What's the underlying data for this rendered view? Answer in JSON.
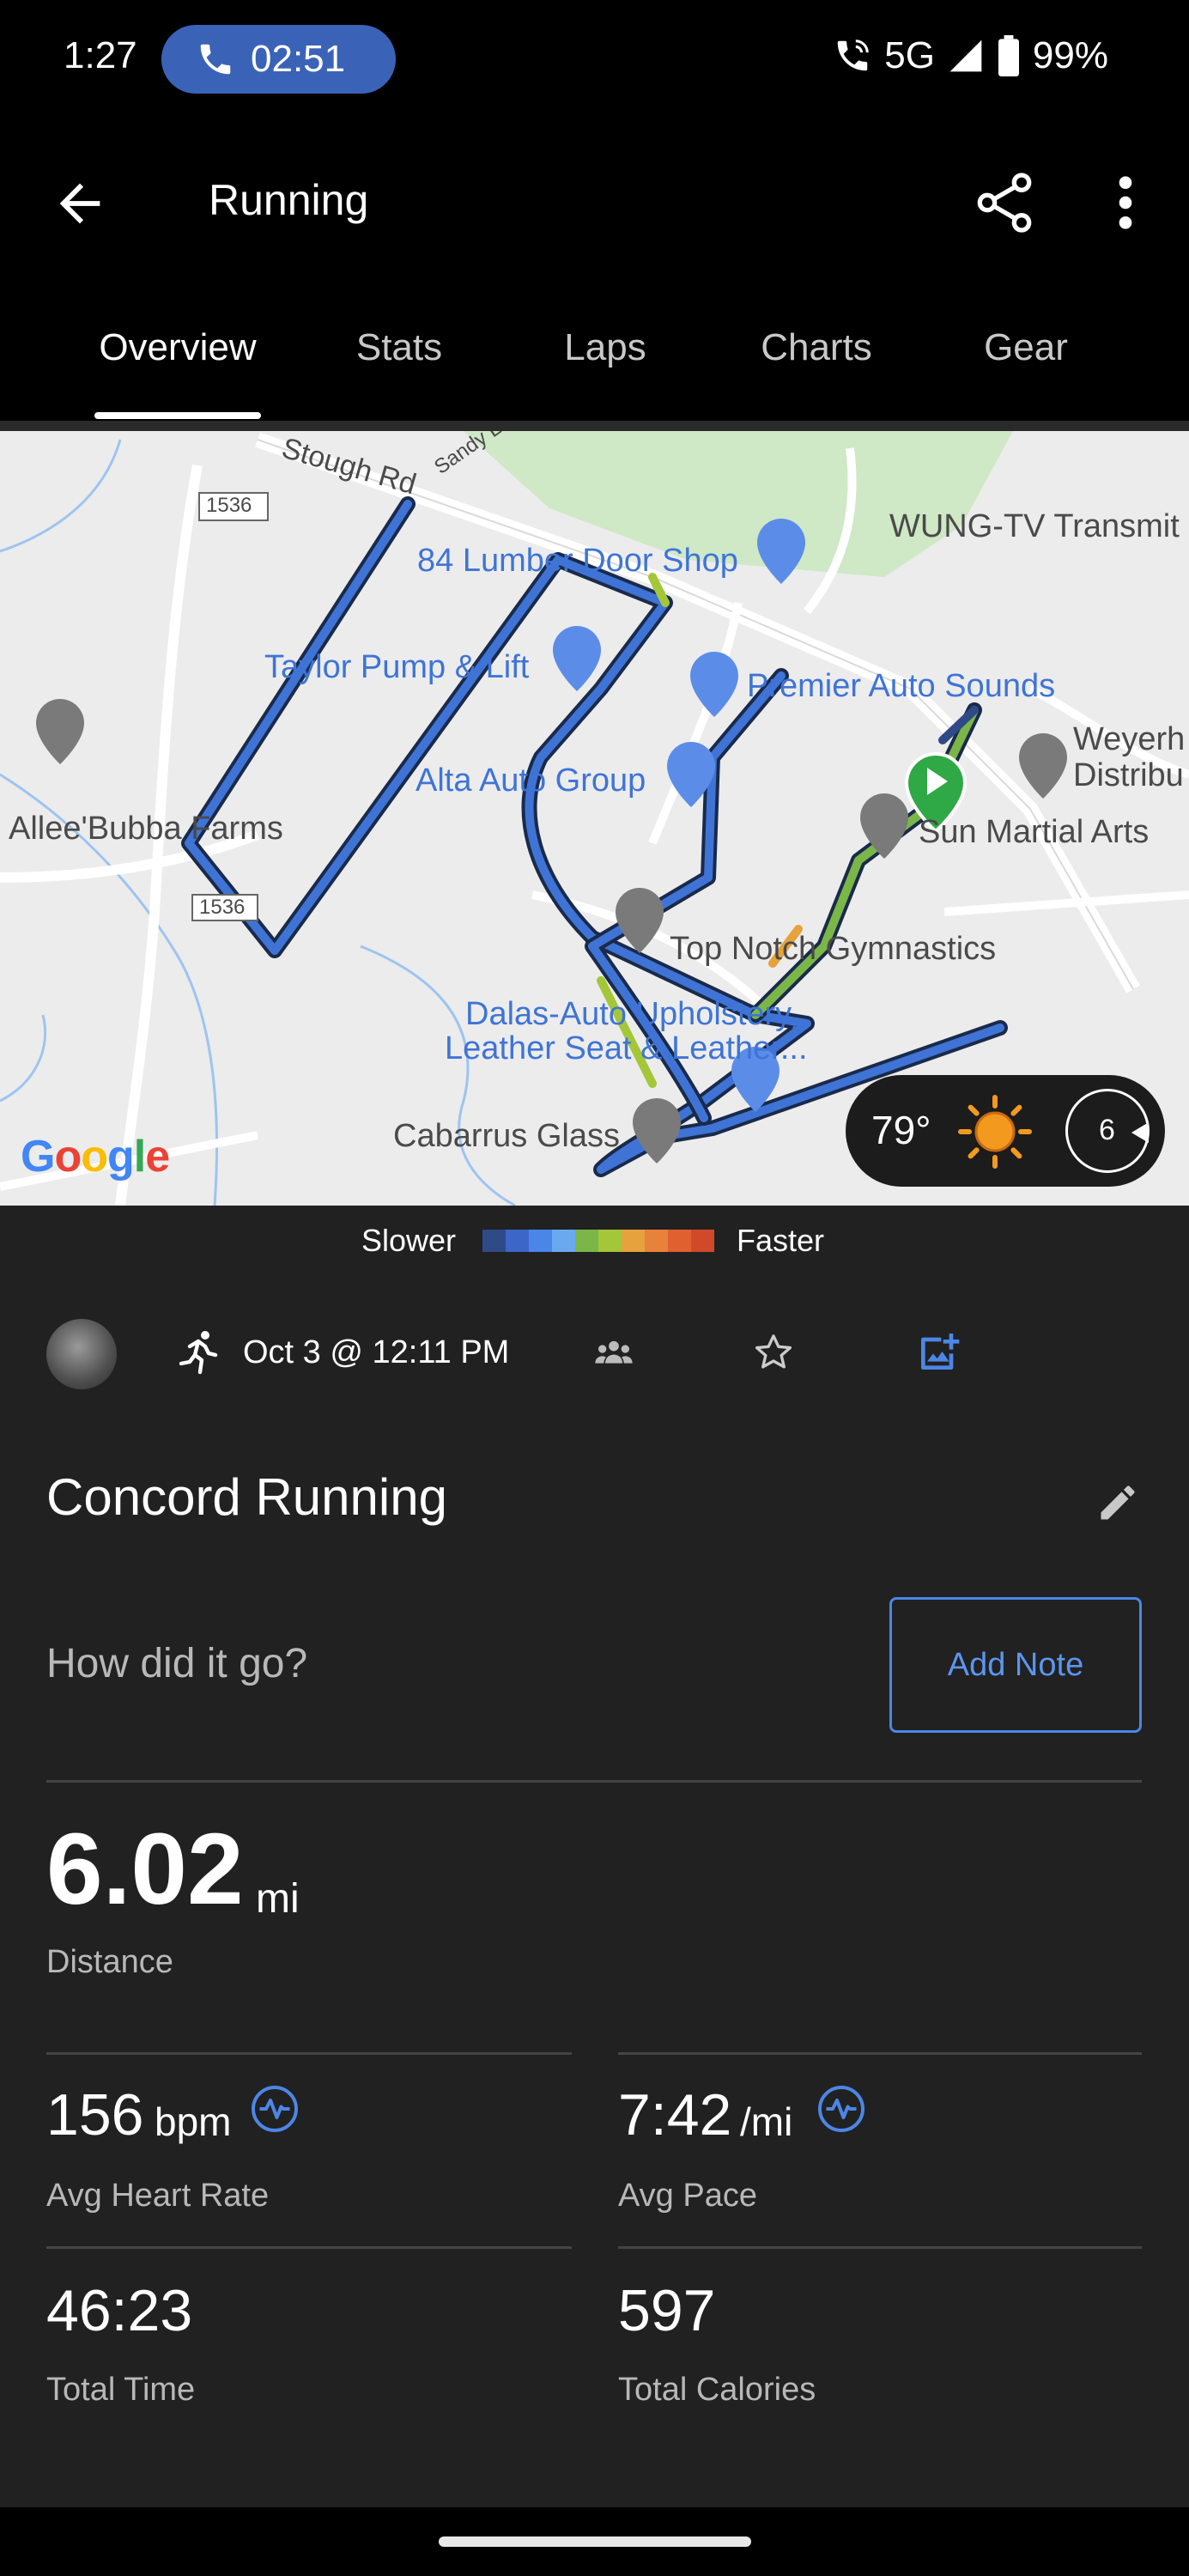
{
  "status_bar": {
    "time": "1:27",
    "call_duration": "02:51",
    "network": "5G",
    "battery": "99%",
    "icons": [
      "phone-icon",
      "wifi-calling-icon",
      "signal-icon",
      "battery-icon"
    ]
  },
  "app_bar": {
    "title": "Running",
    "icons": [
      "back-arrow-icon",
      "share-icon",
      "more-vert-icon"
    ]
  },
  "tabs": [
    {
      "label": "Overview",
      "active": true
    },
    {
      "label": "Stats",
      "active": false
    },
    {
      "label": "Laps",
      "active": false
    },
    {
      "label": "Charts",
      "active": false
    },
    {
      "label": "Gear",
      "active": false
    }
  ],
  "map": {
    "labels": {
      "stough_rd": "Stough Rd",
      "sandy": "Sandy Ln",
      "road_1536_top": "1536",
      "road_1536_bottom": "1536",
      "lumber": "84 Lumber Door Shop",
      "wung": "WUNG-TV Transmit",
      "taylor": "Taylor Pump & Lift",
      "premier": "Premier Auto Sounds",
      "weyerh": "Weyerh",
      "distribu": "Distribu",
      "alta": "Alta Auto Group",
      "allee": "Allee'Bubba Farms",
      "sun_martial": "Sun Martial Arts",
      "top_notch": "Top Notch Gymnastics",
      "dalas_1": "Dalas-Auto Upholstery,",
      "dalas_2": "Leather Seat & Leather...",
      "cabarrus": "Cabarrus Glass",
      "google": "Google"
    },
    "weather": {
      "temperature": "79°",
      "wind_speed": "6",
      "icons": [
        "sun-icon",
        "wind-direction-icon"
      ]
    },
    "route_start_icon": "start-flag-icon"
  },
  "legend": {
    "slower_label": "Slower",
    "faster_label": "Faster",
    "colors": [
      "#2f4a86",
      "#3d66c9",
      "#4a86e8",
      "#6aa8f0",
      "#7ab648",
      "#a4c639",
      "#e6a23c",
      "#e8823a",
      "#e06030",
      "#d04a2a"
    ]
  },
  "activity": {
    "date": "Oct 3 @ 12:11 PM",
    "title": "Concord Running",
    "note_prompt": "How did it go?",
    "add_note_label": "Add Note",
    "icons": [
      "avatar",
      "running-icon",
      "group-icon",
      "star-icon",
      "add-photo-icon",
      "edit-icon"
    ]
  },
  "stats": {
    "distance": {
      "value": "6.02",
      "unit": "mi",
      "label": "Distance"
    },
    "avg_heart_rate": {
      "value": "156",
      "unit": "bpm",
      "label": "Avg Heart Rate"
    },
    "avg_pace": {
      "value": "7:42",
      "unit": "/mi",
      "label": "Avg Pace"
    },
    "total_time": {
      "value": "46:23",
      "label": "Total Time"
    },
    "total_calories": {
      "value": "597",
      "label": "Total Calories"
    }
  },
  "colors": {
    "accent": "#4c86e6",
    "background": "#212121",
    "route": "#3f74d6"
  }
}
